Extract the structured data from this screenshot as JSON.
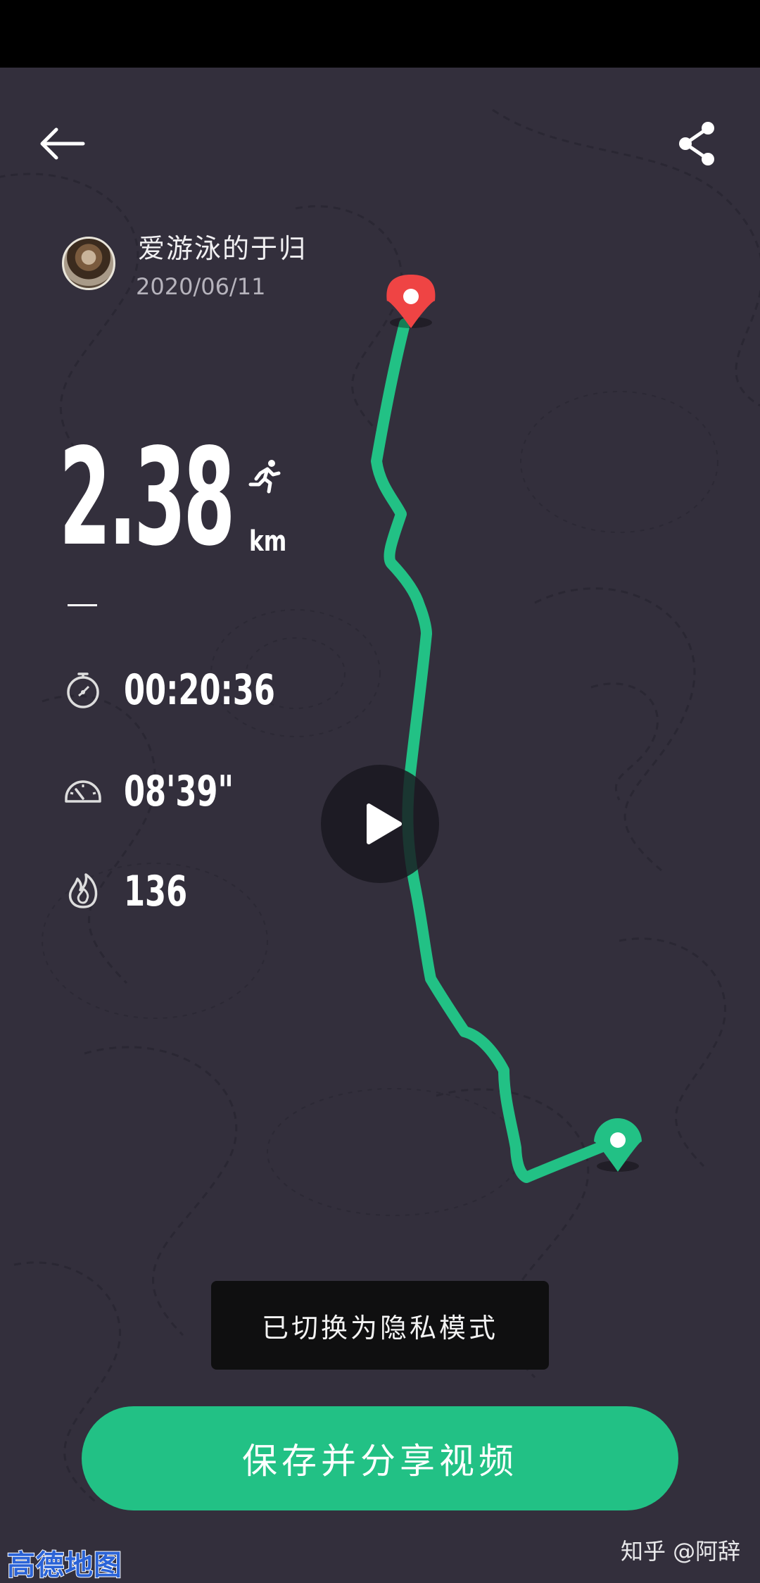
{
  "header": {
    "back_icon": "back-arrow-icon",
    "share_icon": "share-icon"
  },
  "user": {
    "name": "爱游泳的于归",
    "date": "2020/06/11"
  },
  "workout": {
    "distance": "2.38",
    "distance_unit": "km",
    "activity_icon": "running-icon",
    "separator": "—",
    "duration": "00:20:36",
    "pace": "08'39\"",
    "calories": "136"
  },
  "map": {
    "route_color": "#22c185",
    "start_marker_color": "#ef4444",
    "end_marker_color": "#22c185"
  },
  "toast": {
    "message": "已切换为隐私模式"
  },
  "actions": {
    "save_share_label": "保存并分享视频",
    "play_icon": "play-icon"
  },
  "watermarks": {
    "left": "高德地图",
    "right": "知乎 @阿辞"
  }
}
